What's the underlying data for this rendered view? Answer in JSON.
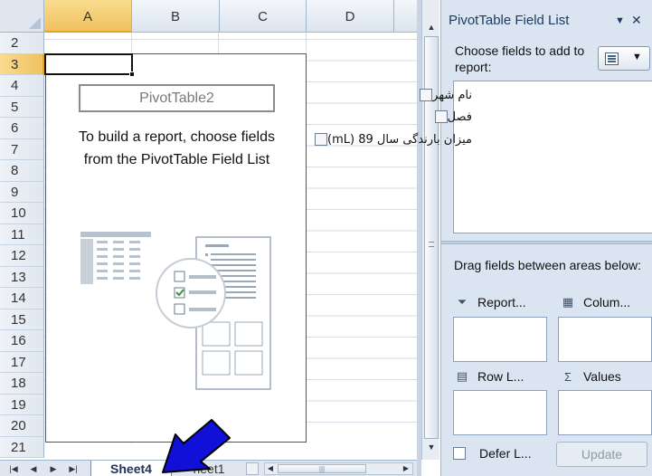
{
  "spreadsheet": {
    "columns": [
      "A",
      "B",
      "C",
      "D"
    ],
    "rows": [
      "2",
      "3",
      "4",
      "5",
      "6",
      "7",
      "8",
      "9",
      "10",
      "11",
      "12",
      "13",
      "14",
      "15",
      "16",
      "17",
      "18",
      "19",
      "20",
      "21"
    ],
    "selected_column": "A",
    "selected_row": "3"
  },
  "pivot_placeholder": {
    "name": "PivotTable2",
    "message_line1": "To build a report, choose fields",
    "message_line2": "from the PivotTable Field List"
  },
  "sheet_tabs": {
    "active": "Sheet4",
    "other": "heet1",
    "nav_icons": [
      "first-sheet-icon",
      "prev-sheet-icon",
      "next-sheet-icon",
      "last-sheet-icon"
    ]
  },
  "field_list": {
    "title": "PivotTable Field List",
    "choose_label": "Choose fields to add to report:",
    "fields": [
      "نام شهر",
      "فصل",
      "میزان بارندگی سال 89 (mL)"
    ],
    "drag_label": "Drag fields between areas below:",
    "areas": {
      "report_filter": "Report...",
      "column_labels": "Colum...",
      "row_labels": "Row L...",
      "values": "Values"
    },
    "defer_label": "Defer L...",
    "update_label": "Update"
  },
  "colors": {
    "pane_bg": "#dbe5f1",
    "header_selected": "#f1c15f",
    "arrow_fill": "#1010d8"
  }
}
